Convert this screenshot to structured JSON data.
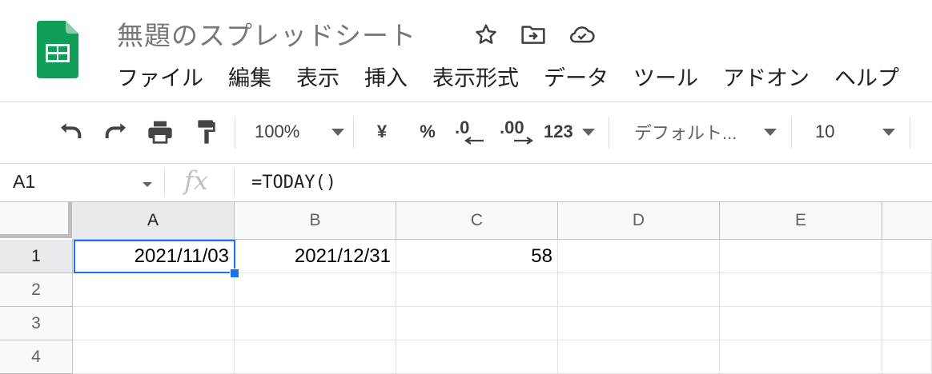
{
  "app": {
    "doc_title": "無題のスプレッドシート",
    "brand_color": "#0f9d58"
  },
  "title_icons": [
    "star-icon",
    "move-to-folder-icon",
    "cloud-saved-icon"
  ],
  "menu": [
    "ファイル",
    "編集",
    "表示",
    "挿入",
    "表示形式",
    "データ",
    "ツール",
    "アドオン",
    "ヘルプ"
  ],
  "toolbar": {
    "zoom": "100%",
    "currency": "¥",
    "percent": "%",
    "decrease_decimal": ".0",
    "increase_decimal": ".00",
    "more_formats": "123",
    "font": "デフォルト...",
    "font_size": "10"
  },
  "formula_bar": {
    "name_box": "A1",
    "fx": "fx",
    "formula": "=TODAY()"
  },
  "sheet": {
    "columns": [
      "A",
      "B",
      "C",
      "D",
      "E"
    ],
    "rows": [
      "1",
      "2",
      "3",
      "4"
    ],
    "cells": [
      [
        "2021/11/03",
        "2021/12/31",
        "58",
        "",
        ""
      ],
      [
        "",
        "",
        "",
        "",
        ""
      ],
      [
        "",
        "",
        "",
        "",
        ""
      ],
      [
        "",
        "",
        "",
        "",
        ""
      ]
    ],
    "selected_cell": "A1",
    "selection_color": "#1a73e8"
  }
}
